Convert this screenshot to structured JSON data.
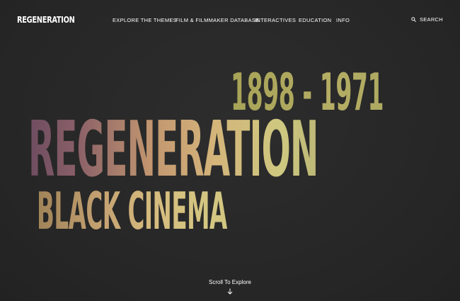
{
  "header": {
    "logo": "REGENERATION",
    "nav": [
      {
        "label": "EXPLORE THE THEMES",
        "id": "explore-themes"
      },
      {
        "label": "FILM & FILMMAKER DATABASE",
        "id": "film-database"
      },
      {
        "label": "INTERACTIVES",
        "id": "interactives"
      },
      {
        "label": "EDUCATION",
        "id": "education"
      },
      {
        "label": "INFO",
        "id": "info"
      }
    ],
    "search_label": "SEARCH",
    "search_icon": "search-icon"
  },
  "hero": {
    "years": "1898 - 1971",
    "title": "REGENERATION",
    "subtitle": "BLACK CINEMA"
  },
  "scroll": {
    "label": "Scroll To Explore",
    "icon": "arrow-down-icon"
  },
  "colors": {
    "background": "#272727",
    "text": "#ffffff",
    "gradient_purple": "#6e4c60",
    "gradient_peach": "#d4b47a",
    "gradient_yellow": "#cec880",
    "gradient_olive": "#a8a65f"
  }
}
